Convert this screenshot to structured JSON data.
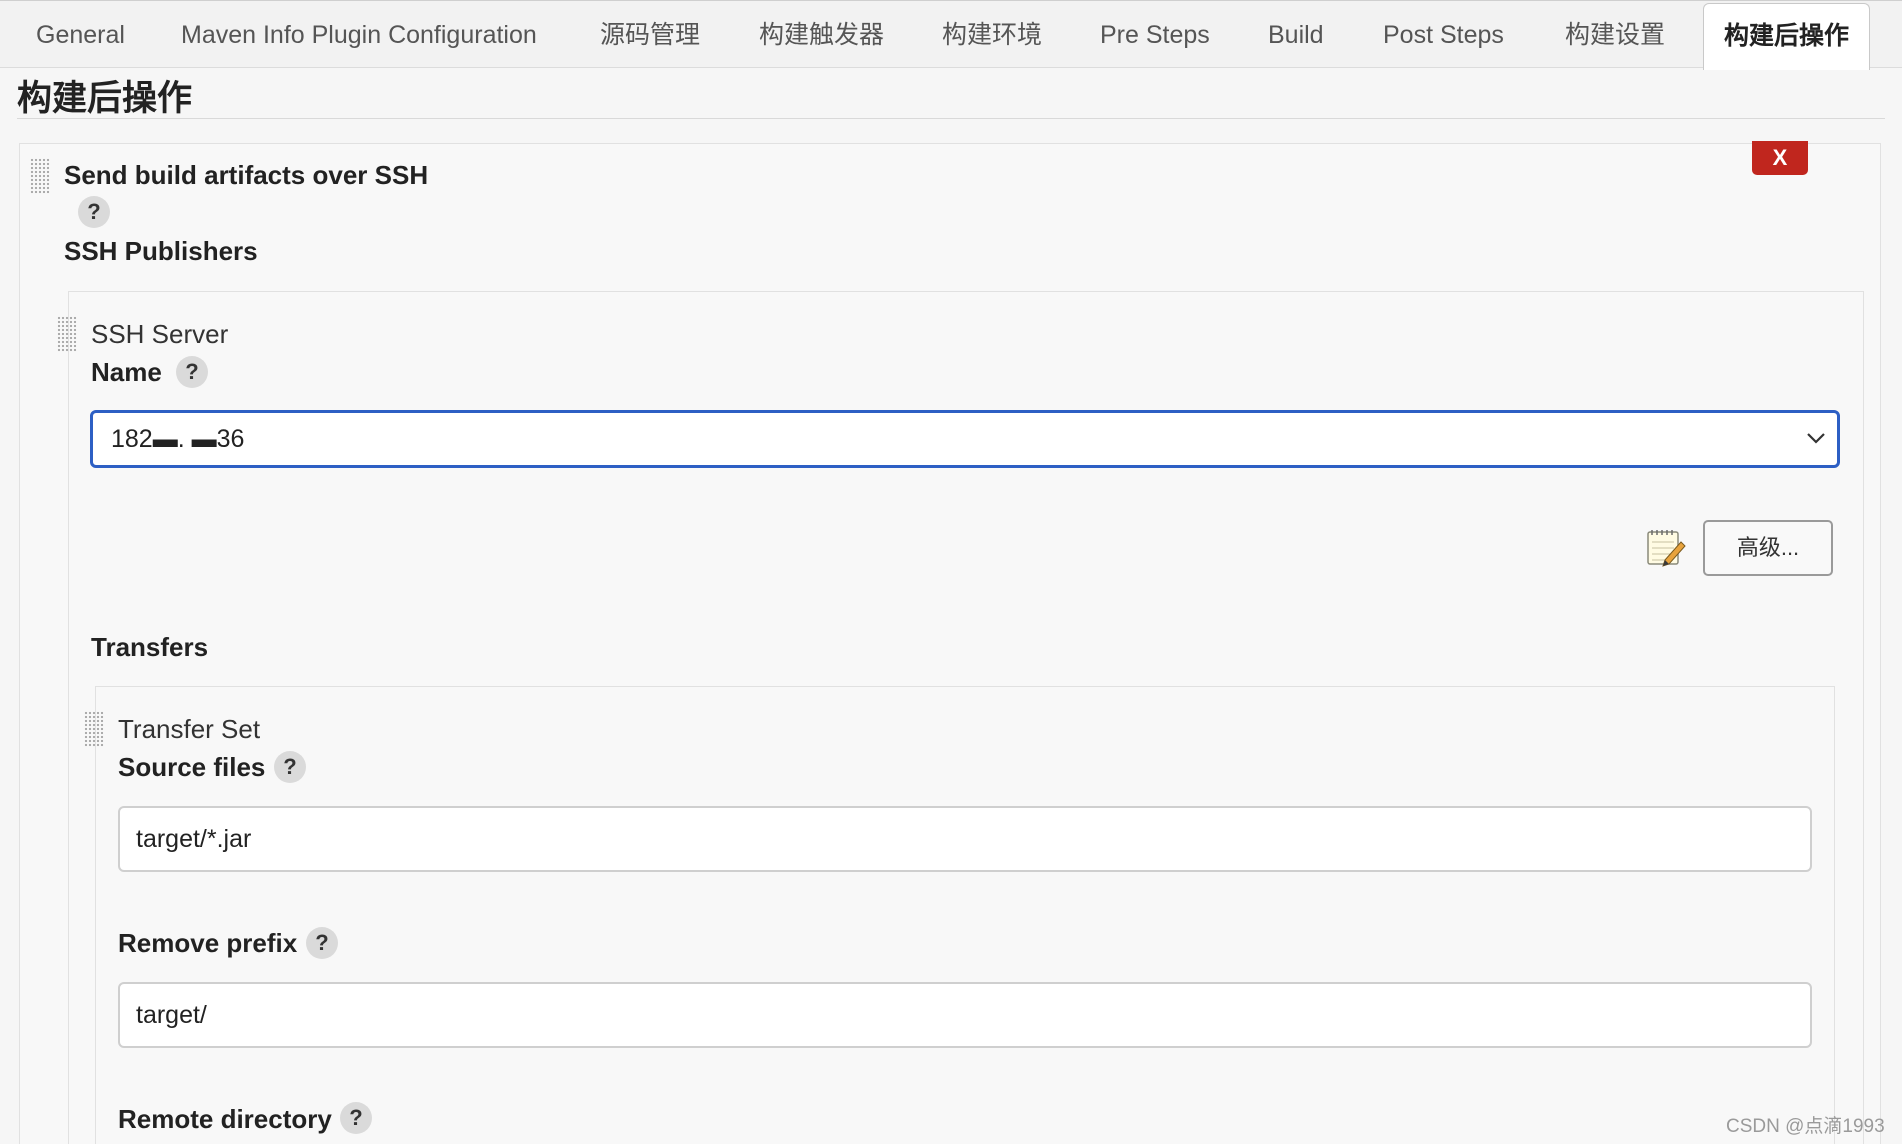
{
  "tabs": [
    {
      "label": "General"
    },
    {
      "label": "Maven Info Plugin Configuration"
    },
    {
      "label": "源码管理"
    },
    {
      "label": "构建触发器"
    },
    {
      "label": "构建环境"
    },
    {
      "label": "Pre Steps"
    },
    {
      "label": "Build"
    },
    {
      "label": "Post Steps"
    },
    {
      "label": "构建设置"
    },
    {
      "label": "构建后操作"
    }
  ],
  "active_tab": "构建后操作",
  "section": {
    "title": "构建后操作"
  },
  "publisher": {
    "title": "Send build artifacts over SSH",
    "delete_label": "X",
    "help_label": "?",
    "ssh_publishers_label": "SSH Publishers"
  },
  "ssh_server": {
    "title": "SSH Server",
    "name_label": "Name",
    "help_label": "?",
    "name_value": "182▬.     ▬36",
    "advanced_label": "高级..."
  },
  "transfers": {
    "label": "Transfers",
    "set_title": "Transfer Set",
    "source_files_label": "Source files",
    "source_files_value": "target/*.jar",
    "remove_prefix_label": "Remove prefix",
    "remove_prefix_value": "target/",
    "remote_directory_label": "Remote directory",
    "help_label": "?"
  },
  "watermark": "CSDN @点滴1993",
  "colors": {
    "accent": "#2d5fc4",
    "delete": "#c0261e"
  }
}
